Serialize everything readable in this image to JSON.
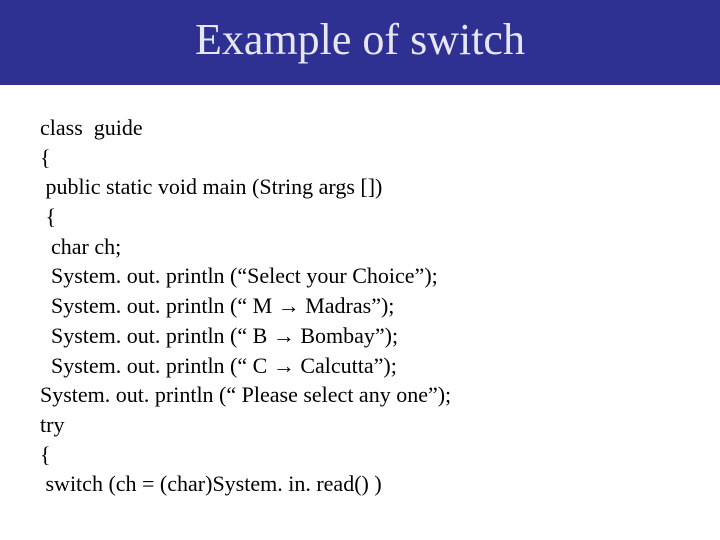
{
  "header": {
    "title": "Example of switch"
  },
  "code": {
    "l1": "class  guide",
    "l2": "{",
    "l3": " public static void main (String args [])",
    "l4": " {",
    "l5": "  char ch;",
    "l6": "  System. out. println (“Select your Choice”);",
    "l7": "  System. out. println (“ M → Madras”);",
    "l8": "  System. out. println (“ B → Bombay”);",
    "l9": "  System. out. println (“ C → Calcutta”);",
    "l10": "System. out. println (“ Please select any one”);",
    "l11": "try",
    "l12": "{",
    "l13": " switch (ch = (char)System. in. read() )"
  }
}
